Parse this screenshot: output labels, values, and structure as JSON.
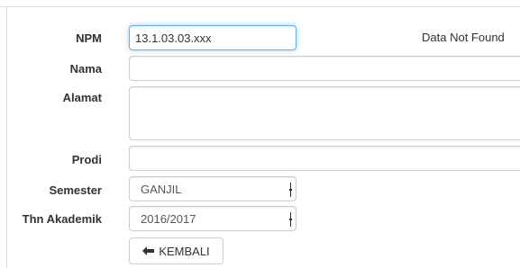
{
  "form": {
    "npm": {
      "label": "NPM",
      "value": "13.1.03.03.xxx"
    },
    "status": "Data Not Found",
    "nama": {
      "label": "Nama",
      "value": ""
    },
    "alamat": {
      "label": "Alamat",
      "value": ""
    },
    "prodi": {
      "label": "Prodi",
      "value": ""
    },
    "semester": {
      "label": "Semester",
      "value": "GANJIL"
    },
    "thn_akademik": {
      "label": "Thn Akademik",
      "value": "2016/2017"
    }
  },
  "buttons": {
    "back": {
      "label": "KEMBALI",
      "icon": "arrow-left-icon"
    }
  }
}
